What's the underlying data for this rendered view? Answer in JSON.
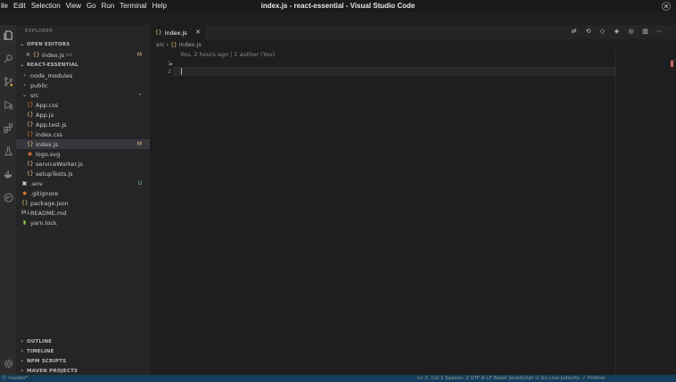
{
  "window": {
    "title": "index.js - react-essential - Visual Studio Code"
  },
  "menu": [
    "ile",
    "Edit",
    "Selection",
    "View",
    "Go",
    "Run",
    "Terminal",
    "Help"
  ],
  "sidebar": {
    "title": "EXPLORER",
    "open_editors": {
      "header": "OPEN EDITORS",
      "items": [
        {
          "close": "✕",
          "icon": "{}",
          "name": "index.js",
          "folder": "src",
          "badge": "M"
        }
      ]
    },
    "project": {
      "header": "REACT-ESSENTIAL",
      "items": [
        {
          "icon": "chevron-right-icon",
          "glyph": "›",
          "name": "node_modules",
          "badge": ""
        },
        {
          "icon": "chevron-right-icon",
          "glyph": "›",
          "name": "public",
          "badge": ""
        },
        {
          "icon": "chevron-down-icon",
          "glyph": "⌄",
          "name": "src",
          "badge": "•"
        },
        {
          "icon": "css-file-icon",
          "glyph": "{}",
          "name": "App.css",
          "badge": ""
        },
        {
          "icon": "js-file-icon",
          "glyph": "{}",
          "name": "App.js",
          "badge": ""
        },
        {
          "icon": "js-file-icon",
          "glyph": "{}",
          "name": "App.test.js",
          "badge": ""
        },
        {
          "icon": "css-file-icon",
          "glyph": "{}",
          "name": "index.css",
          "badge": ""
        },
        {
          "icon": "js-file-icon",
          "glyph": "{}",
          "name": "index.js",
          "badge": "M"
        },
        {
          "icon": "svg-file-icon",
          "glyph": "◉",
          "name": "logo.svg",
          "badge": ""
        },
        {
          "icon": "js-file-icon",
          "glyph": "{}",
          "name": "serviceWorker.js",
          "badge": ""
        },
        {
          "icon": "js-file-icon",
          "glyph": "{}",
          "name": "setupTests.js",
          "badge": ""
        },
        {
          "icon": "lock-icon",
          "glyph": "▣",
          "name": ".env",
          "badge": "U"
        },
        {
          "icon": "git-icon",
          "glyph": "◆",
          "name": ".gitignore",
          "badge": ""
        },
        {
          "icon": "json-file-icon",
          "glyph": "{}",
          "name": "package.json",
          "badge": ""
        },
        {
          "icon": "markdown-icon",
          "glyph": "M↓",
          "name": "README.md",
          "badge": ""
        },
        {
          "icon": "yarn-file-icon",
          "glyph": "▮",
          "name": "yarn.lock",
          "badge": ""
        }
      ]
    },
    "bottom_sections": [
      "OUTLINE",
      "TIMELINE",
      "NPM SCRIPTS",
      "MAVEN PROJECTS"
    ]
  },
  "editor": {
    "tab": {
      "icon": "{}",
      "label": "index.js",
      "close": "✕"
    },
    "breadcrumb": {
      "folder": "src",
      "separator": "›",
      "icon": "{}",
      "file": "index.js"
    },
    "codelens": "You, 2 hours ago | 1 author (You)",
    "lines": [
      "1",
      "2"
    ],
    "fold": "▸"
  },
  "statusbar": {
    "left": "ⓟ master*",
    "right": "Ln 2, Col 1    Spaces: 2    UTF-8    LF    Babel JavaScript    ⊙ Go Live    jsdocify: ✓    Prettier"
  },
  "colors": {
    "accent": "#007acc",
    "modified": "#e2c08d",
    "untracked": "#73c991",
    "js": "#e8c47a"
  }
}
